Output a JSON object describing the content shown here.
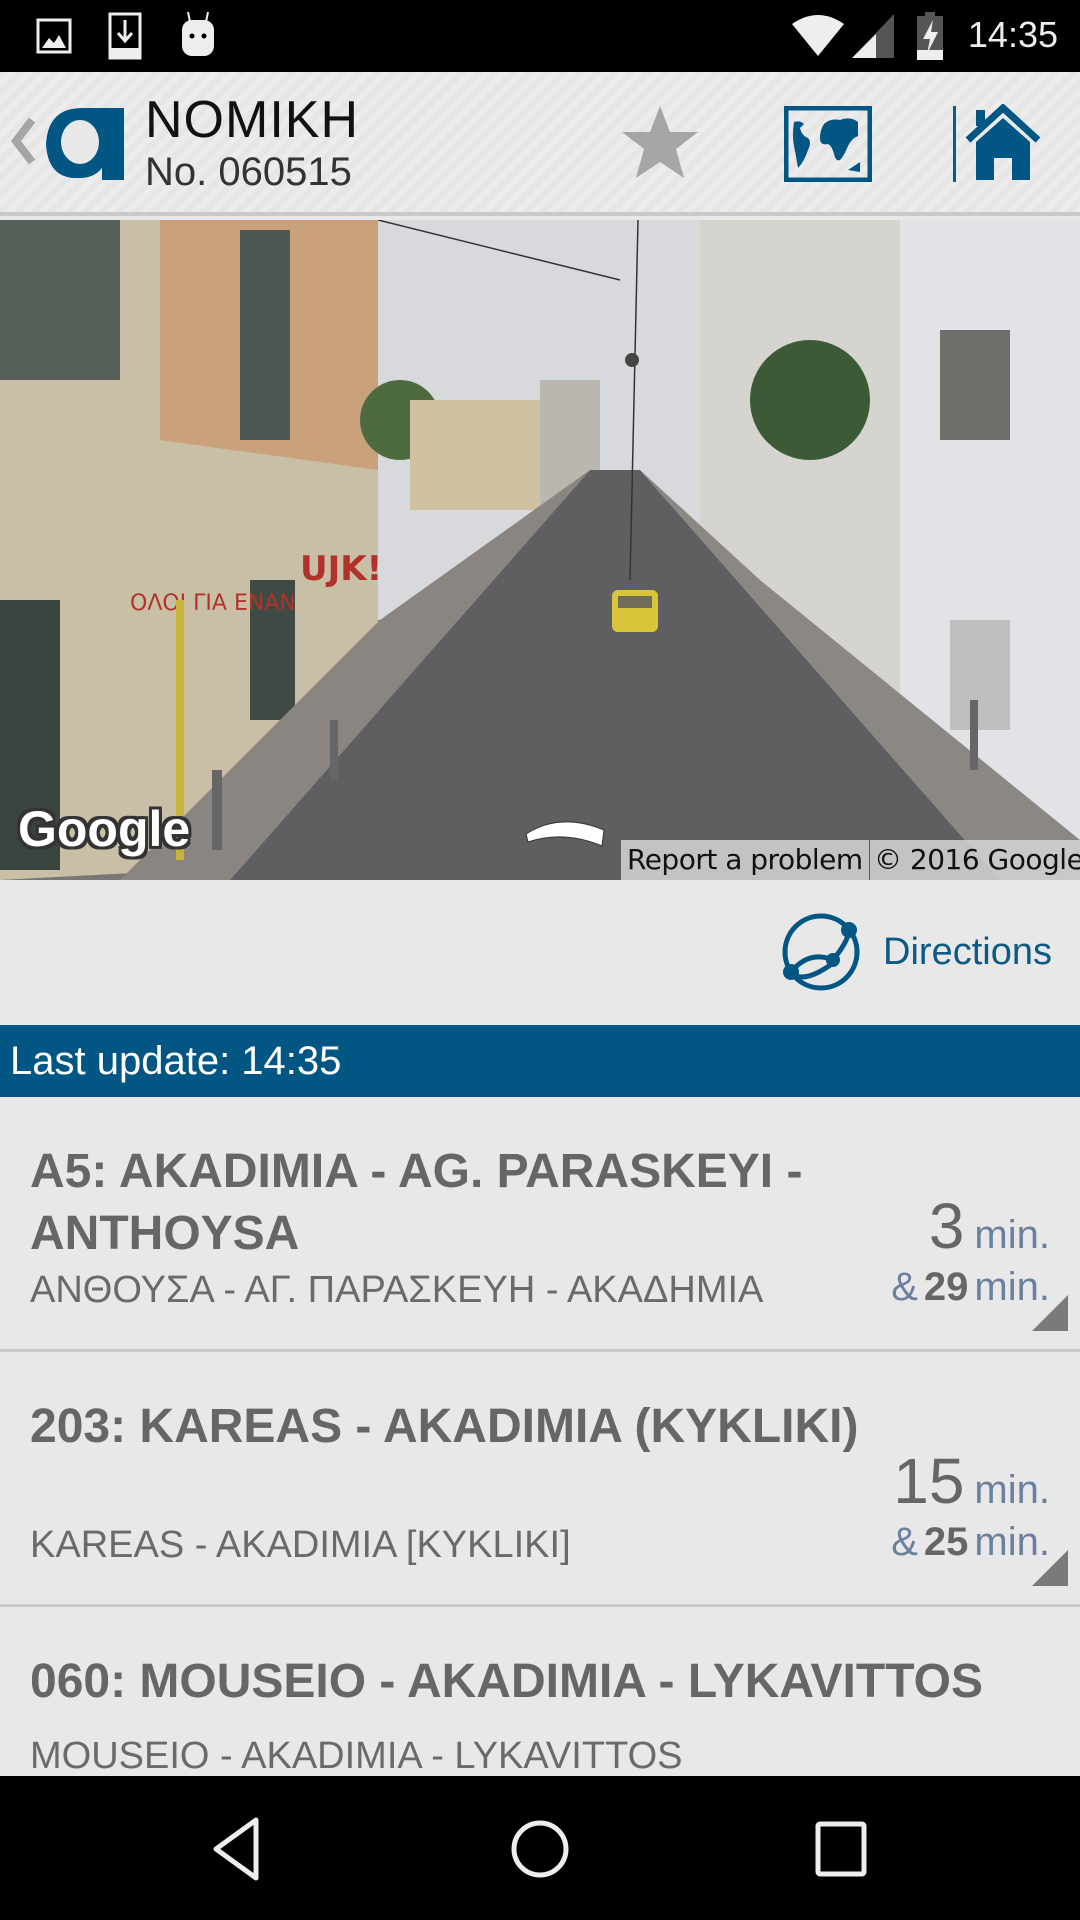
{
  "status_bar": {
    "time": "14:35",
    "left_icons": [
      "image-notification-icon",
      "download-notification-icon",
      "android-debug-icon"
    ],
    "right_icons": [
      "wifi-icon",
      "cell-signal-icon",
      "battery-charging-icon"
    ]
  },
  "header": {
    "title": "NOMIKH",
    "stop_number": "No. 060515",
    "logo": "oasa-alpha-logo",
    "actions": [
      "favorite-star",
      "map",
      "home"
    ]
  },
  "street_view": {
    "logo_text": "Google",
    "report_label": "Report a problem",
    "copyright": "© 2016 Google"
  },
  "directions": {
    "label": "Directions"
  },
  "update": {
    "label": "Last update: 14:35"
  },
  "routes": [
    {
      "title": "A5: AKADIMIA - AG. PARASKEYI - ANTHOYSA",
      "subtitle": "ΑΝΘΟΥΣΑ - ΑΓ. ΠΑΡΑΣΚΕΥΗ - ΑΚΑΔΗΜΙΑ",
      "eta_first": "3",
      "eta_first_unit": "min.",
      "eta_amp": "&",
      "eta_second": "29",
      "eta_second_unit": "min."
    },
    {
      "title": "203: KAREAS - AKADIMIA (KYKLIKI)",
      "subtitle": "KAREAS - AKADIMIA [KYKLIKI]",
      "eta_first": "15",
      "eta_first_unit": "min.",
      "eta_amp": "&",
      "eta_second": "25",
      "eta_second_unit": "min."
    },
    {
      "title": "060: MOUSEIO - AKADIMIA - LYKAVITTOS",
      "subtitle": "MOUSEIO - AKADIMIA - LYKAVITTOS"
    }
  ],
  "colors": {
    "brand_blue": "#025683",
    "background": "#e8e8e8",
    "route_text": "#666666",
    "unit_text": "#6b7f9e"
  }
}
